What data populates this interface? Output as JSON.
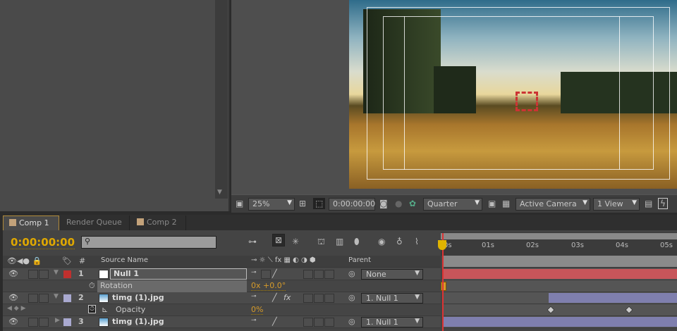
{
  "viewer": {
    "zoom": "25%",
    "timecode": "0:00:00:00",
    "resolution": "Quarter",
    "camera": "Active Camera",
    "views": "1 View"
  },
  "tabs": [
    {
      "label": "Comp 1",
      "active": true,
      "close": "×"
    },
    {
      "label": "Render Queue"
    },
    {
      "label": "Comp 2"
    }
  ],
  "timeline": {
    "timecode": "0:00:00:00",
    "search_placeholder": "",
    "ruler": [
      "0s",
      "01s",
      "02s",
      "03s",
      "04s",
      "05s"
    ],
    "columns": {
      "num": "#",
      "source": "Source Name",
      "parent": "Parent"
    },
    "layers": [
      {
        "num": "1",
        "name": "Null 1",
        "label_color": "#c0302e",
        "parent": "None",
        "bar_color": "#c8555a"
      },
      {
        "prop": "Rotation",
        "value": "0x +0.0°"
      },
      {
        "num": "2",
        "name": "timg (1).jpg",
        "label_color": "#a9a9d0",
        "parent": "1. Null 1",
        "bar_color": "#7f7fae"
      },
      {
        "prop": "Opacity",
        "value": "0%"
      },
      {
        "num": "3",
        "name": "timg (1).jpg",
        "label_color": "#a9a9d0",
        "parent": "1. Null 1",
        "bar_color": "#7f7fae"
      }
    ]
  },
  "colors": {
    "accent": "#e0a800",
    "playhead": "#dd3333"
  }
}
